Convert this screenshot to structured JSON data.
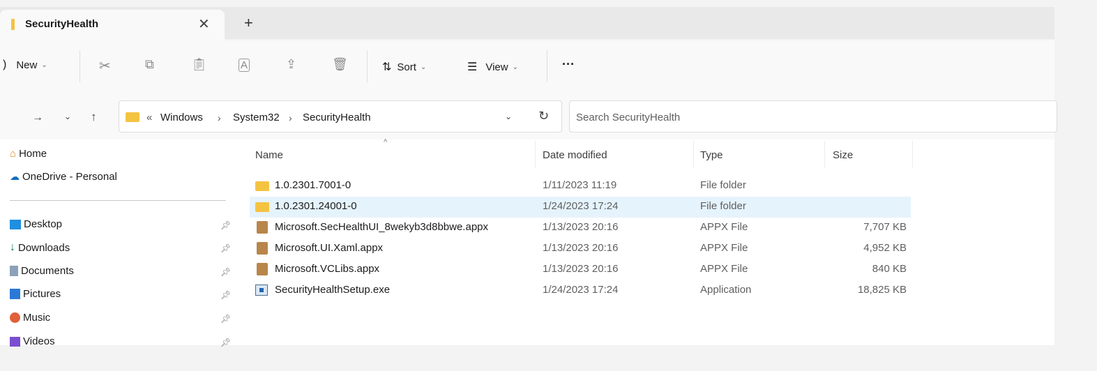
{
  "tab": {
    "title": "SecurityHealth",
    "close": "✕",
    "add": "+"
  },
  "toolbar": {
    "new_label": "New",
    "sort_label": "Sort",
    "view_label": "View",
    "more_label": "···"
  },
  "address": {
    "overflow": "«",
    "crumbs": [
      "Windows",
      "System32",
      "SecurityHealth"
    ],
    "separator": "›"
  },
  "search": {
    "placeholder": "Search SecurityHealth"
  },
  "sidebar": {
    "items": [
      {
        "label": "Home",
        "icon": "home-icon"
      },
      {
        "label": "OneDrive - Personal",
        "icon": "cloud-icon"
      },
      {
        "label": "Desktop",
        "icon": "desktop-icon"
      },
      {
        "label": "Downloads",
        "icon": "download-icon"
      },
      {
        "label": "Documents",
        "icon": "documents-icon"
      },
      {
        "label": "Pictures",
        "icon": "pictures-icon"
      },
      {
        "label": "Music",
        "icon": "music-icon"
      },
      {
        "label": "Videos",
        "icon": "videos-icon"
      }
    ]
  },
  "columns": {
    "name": "Name",
    "date": "Date modified",
    "type": "Type",
    "size": "Size"
  },
  "files": [
    {
      "name": "1.0.2301.7001-0",
      "date": "1/11/2023 11:19",
      "type": "File folder",
      "size": "",
      "icon": "folder-icon"
    },
    {
      "name": "1.0.2301.24001-0",
      "date": "1/24/2023 17:24",
      "type": "File folder",
      "size": "",
      "icon": "folder-icon"
    },
    {
      "name": "Microsoft.SecHealthUI_8wekyb3d8bbwe.appx",
      "date": "1/13/2023 20:16",
      "type": "APPX File",
      "size": "7,707 KB",
      "icon": "package-icon"
    },
    {
      "name": "Microsoft.UI.Xaml.appx",
      "date": "1/13/2023 20:16",
      "type": "APPX File",
      "size": "4,952 KB",
      "icon": "package-icon"
    },
    {
      "name": "Microsoft.VCLibs.appx",
      "date": "1/13/2023 20:16",
      "type": "APPX File",
      "size": "840 KB",
      "icon": "package-icon"
    },
    {
      "name": "SecurityHealthSetup.exe",
      "date": "1/24/2023 17:24",
      "type": "Application",
      "size": "18,825 KB",
      "icon": "application-icon"
    }
  ],
  "colors": {
    "accent": "#0067c0",
    "folder": "#f4c342",
    "selected_row": "#e5f3fd"
  }
}
